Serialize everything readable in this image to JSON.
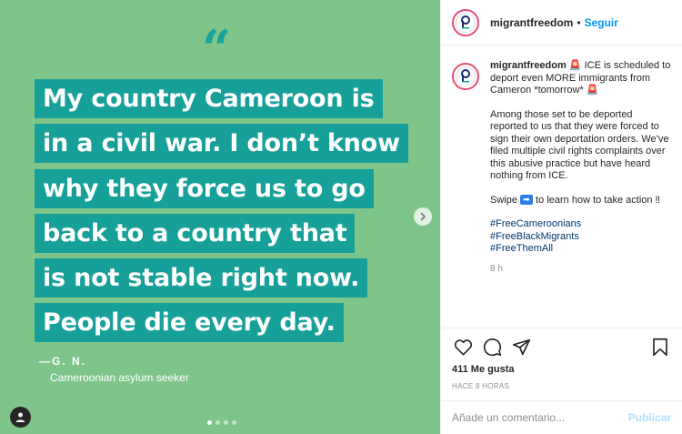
{
  "media": {
    "quote_mark": "“",
    "lines": [
      "My country Cameroon is",
      "in a civil war. I don’t know",
      "why they force us to go",
      "back to a country that",
      "is not stable right now.",
      "People die every day."
    ],
    "attribution": "—G. N.",
    "attribution_sub": "Cameroonian asylum seeker",
    "carousel_total": 4,
    "carousel_active": 1,
    "colors": {
      "background": "#7fc58a",
      "highlight": "#16a099"
    }
  },
  "header": {
    "username": "migrantfreedom",
    "separator": "•",
    "follow_label": "Seguir"
  },
  "caption": {
    "username": "migrantfreedom",
    "intro_emoji": "🚨",
    "intro": "ICE is scheduled to deport even MORE immigrants from Cameron *tomorrow*",
    "intro_emoji_end": "🚨",
    "body": "Among those set to be deported reported to us that they were forced to sign their own deportation orders. We’ve filed multiple civil rights complaints over this abusive practice but have heard nothing from ICE.",
    "swipe_before": "Swipe",
    "swipe_emoji": "➡",
    "swipe_after": "to learn how to take action ‼",
    "hashtags": [
      "#FreeCameroonians",
      "#FreeBlackMigrants",
      "#FreeThemAll"
    ],
    "time_ago": "8 h"
  },
  "actions": {
    "icons": [
      "heart-icon",
      "comment-icon",
      "share-icon",
      "bookmark-icon"
    ],
    "likes": "411 Me gusta",
    "post_date": "HACE 8 HORAS"
  },
  "comment_box": {
    "placeholder": "Añade un comentario...",
    "publish_label": "Publicar"
  }
}
